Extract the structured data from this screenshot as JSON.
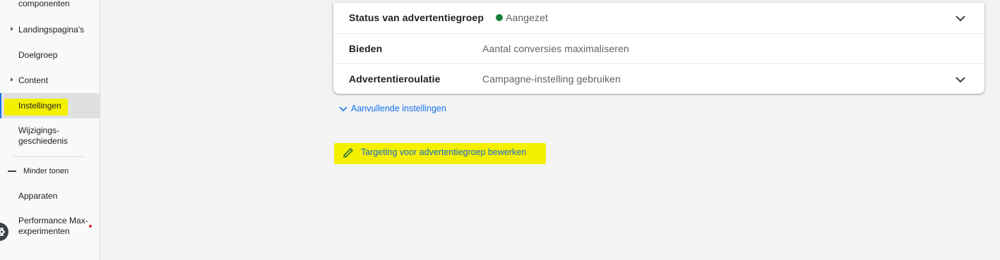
{
  "sidebar": {
    "items": [
      {
        "label": "componenten"
      },
      {
        "label": "Landingspagina's"
      },
      {
        "label": "Doelgroep"
      },
      {
        "label": "Content"
      },
      {
        "label": "Instellingen"
      },
      {
        "label_line1": "Wijzigings-",
        "label_line2": "geschiedenis"
      },
      {
        "label": "Minder tonen"
      },
      {
        "label": "Apparaten"
      },
      {
        "label_line1": "Performance Max-",
        "label_line2": "experimenten"
      }
    ],
    "active_item": "Instellingen"
  },
  "settings": {
    "status": {
      "label": "Status van advertentiegroep",
      "value": "Aangezet"
    },
    "bidding": {
      "label": "Bieden",
      "value": "Aantal conversies maximaliseren"
    },
    "rotation": {
      "label": "Advertentieroulatie",
      "value": "Campagne-instelling gebruiken"
    }
  },
  "links": {
    "more_settings": "Aanvullende instellingen",
    "edit_targeting": "Targeting voor advertentiegroep bewerken"
  },
  "icons": {
    "expand": "chevron-down-icon",
    "edit": "pencil-icon",
    "collapse": "close-icon"
  },
  "colors": {
    "accent": "#1a73e8",
    "status_on": "#188038",
    "highlight": "#f4f000",
    "new_dot": "#d93025"
  }
}
